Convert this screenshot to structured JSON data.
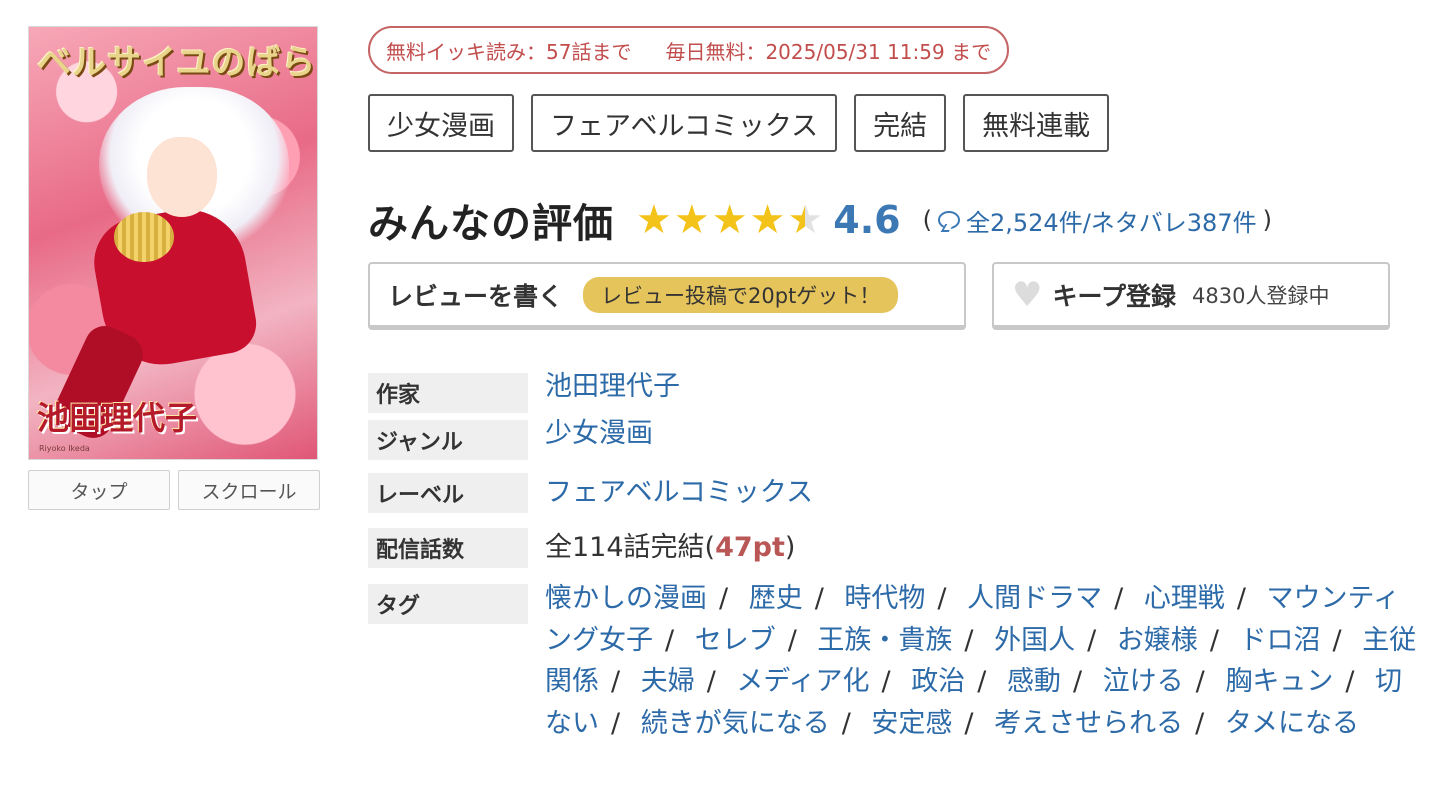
{
  "cover": {
    "title_art": "ベルサイユのばら",
    "author_art": "池田理代子",
    "romaji": "Riyoko Ikeda"
  },
  "view_buttons": {
    "tap": "タップ",
    "scroll": "スクロール"
  },
  "free_badge": {
    "ikki": "無料イッキ読み：57話まで",
    "daily": "毎日無料：2025/05/31 11:59 まで"
  },
  "top_tags": [
    "少女漫画",
    "フェアベルコミックス",
    "完結",
    "無料連載"
  ],
  "rating": {
    "label": "みんなの評価",
    "score": "4.6",
    "stars_value": 4.6,
    "open_paren": "(",
    "count": "全2,524件/ネタバレ387件",
    "close_paren": ")"
  },
  "actions": {
    "review_label": "レビューを書く",
    "review_promo": "レビュー投稿で20ptゲット！",
    "keep_label": "キープ登録",
    "keep_count": "4830人登録中"
  },
  "info": {
    "author_key": "作家",
    "author_val": "池田理代子",
    "genre_key": "ジャンル",
    "genre_val": "少女漫画",
    "label_key": "レーベル",
    "label_val": "フェアベルコミックス",
    "episodes_key": "配信話数",
    "episodes_val": "全114話完結(",
    "episodes_pt": "47pt",
    "episodes_close": ")",
    "tags_key": "タグ",
    "tags": [
      "懐かしの漫画",
      "歴史",
      "時代物",
      "人間ドラマ",
      "心理戦",
      "マウンティング女子",
      "セレブ",
      "王族・貴族",
      "外国人",
      "お嬢様",
      "ドロ沼",
      "主従関係",
      "夫婦",
      "メディア化",
      "政治",
      "感動",
      "泣ける",
      "胸キュン",
      "切ない",
      "続きが気になる",
      "安定感",
      "考えさせられる",
      "タメになる"
    ]
  },
  "colors": {
    "link": "#2d6aa8",
    "star": "#f3c319",
    "badge": "#c24d4d",
    "promo": "#e6c45c"
  }
}
